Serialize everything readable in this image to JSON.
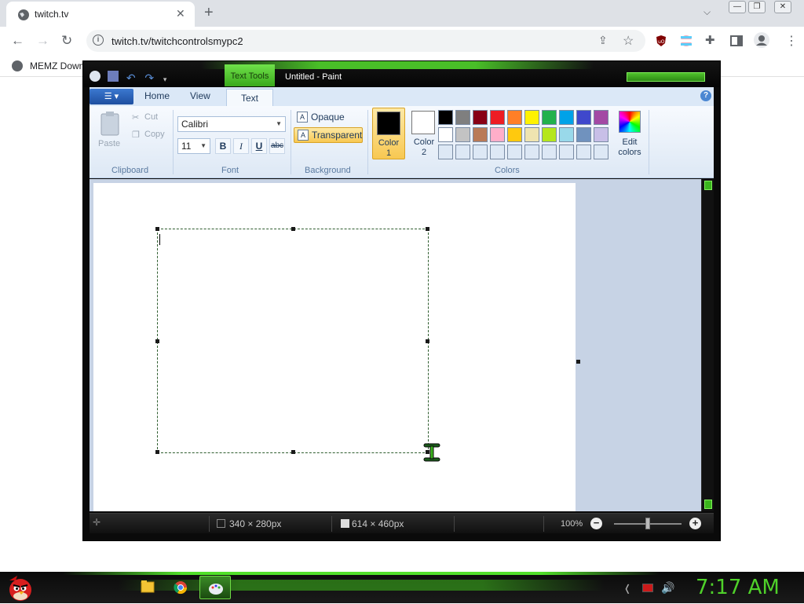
{
  "browser": {
    "tab_title": "twitch.tv",
    "url": "twitch.tv/twitchcontrolsmypc2",
    "bookmark": "MEMZ Down"
  },
  "paint": {
    "context_tab": "Text Tools",
    "window_title": "Untitled - Paint",
    "tabs": [
      "Home",
      "View",
      "Text"
    ],
    "clipboard": {
      "paste": "Paste",
      "cut": "Cut",
      "copy": "Copy",
      "label": "Clipboard"
    },
    "font": {
      "family": "Calibri",
      "size": "11",
      "bold": "B",
      "italic": "I",
      "underline": "U",
      "strike": "abc",
      "label": "Font"
    },
    "background": {
      "opaque": "Opaque",
      "transparent": "Transparent",
      "label": "Background"
    },
    "colors": {
      "color1": "Color 1",
      "color2": "Color 2",
      "edit": "Edit colors",
      "label": "Colors",
      "color1_value": "#000000",
      "color2_value": "#ffffff",
      "palette_row1": [
        "#000000",
        "#7f7f7f",
        "#880015",
        "#ed1c24",
        "#ff7f27",
        "#fff200",
        "#22b14c",
        "#00a2e8",
        "#3f48cc",
        "#a349a4"
      ],
      "palette_row2": [
        "#ffffff",
        "#c3c3c3",
        "#b97a57",
        "#ffaec9",
        "#ffc90e",
        "#efe4b0",
        "#b5e61d",
        "#99d9ea",
        "#7092be",
        "#c8bfe7"
      ],
      "palette_row3": [
        "#dde8f5",
        "#dde8f5",
        "#dde8f5",
        "#dde8f5",
        "#dde8f5",
        "#dde8f5",
        "#dde8f5",
        "#dde8f5",
        "#dde8f5",
        "#dde8f5"
      ]
    },
    "status": {
      "selection": "340 × 280px",
      "image_size": "614 × 460px",
      "zoom": "100%"
    }
  },
  "taskbar": {
    "clock": "7:17 AM"
  },
  "accent": "#4fd12a"
}
